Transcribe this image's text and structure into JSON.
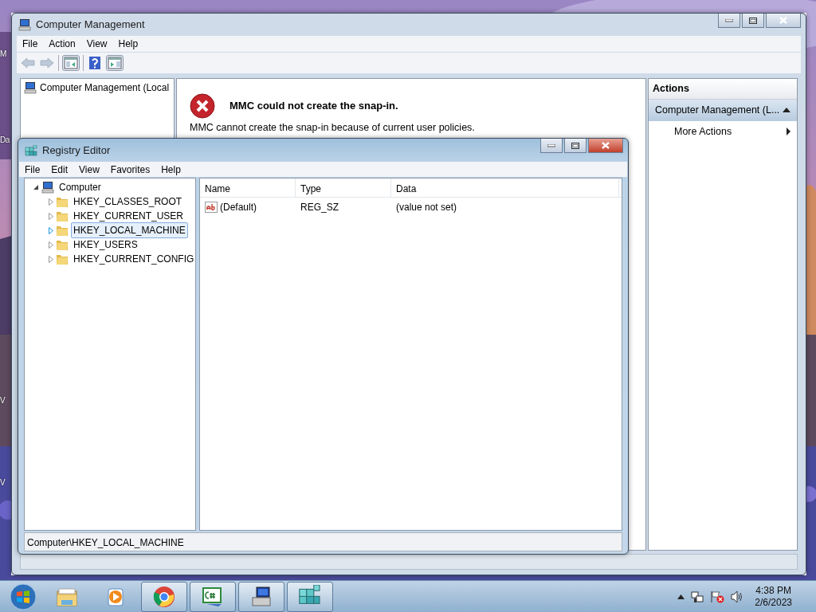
{
  "desktop": {
    "edge_labels": [
      "M",
      "Da",
      "V",
      "V"
    ]
  },
  "computer_management": {
    "title": "Computer Management",
    "menu": [
      "File",
      "Action",
      "View",
      "Help"
    ],
    "toolbar": [
      {
        "kind": "back",
        "disabled": true
      },
      {
        "kind": "forward",
        "disabled": true
      },
      {
        "kind": "tree_pane",
        "disabled": false
      },
      {
        "kind": "help",
        "disabled": false
      },
      {
        "kind": "action_pane",
        "disabled": false
      }
    ],
    "tree": [
      {
        "label": "Computer Management (Local",
        "selected": false
      }
    ],
    "error": {
      "title": "MMC could not create the snap-in.",
      "message": "MMC cannot create the snap-in because of current user policies."
    },
    "actions": {
      "header": "Actions",
      "section": {
        "label": "Computer Management (L...",
        "expanded": true
      },
      "items": [
        {
          "label": "More Actions"
        }
      ]
    }
  },
  "registry_editor": {
    "title": "Registry Editor",
    "menu": [
      "File",
      "Edit",
      "View",
      "Favorites",
      "Help"
    ],
    "tree": {
      "label": "Computer",
      "expanded": true,
      "children": [
        {
          "label": "HKEY_CLASSES_ROOT",
          "expanded": false,
          "selected": false
        },
        {
          "label": "HKEY_CURRENT_USER",
          "expanded": false,
          "selected": false
        },
        {
          "label": "HKEY_LOCAL_MACHINE",
          "expanded": false,
          "selected": true
        },
        {
          "label": "HKEY_USERS",
          "expanded": false,
          "selected": false
        },
        {
          "label": "HKEY_CURRENT_CONFIG",
          "expanded": false,
          "selected": false
        }
      ]
    },
    "columns": [
      "Name",
      "Type",
      "Data"
    ],
    "rows": [
      {
        "name": "(Default)",
        "type": "REG_SZ",
        "data": "(value not set)"
      }
    ],
    "status_bar": "Computer\\HKEY_LOCAL_MACHINE"
  },
  "taskbar": {
    "apps": [
      {
        "kind": "explorer",
        "running": false
      },
      {
        "kind": "media",
        "running": false
      },
      {
        "kind": "chrome",
        "running": true
      },
      {
        "kind": "csharp",
        "running": true
      },
      {
        "kind": "mmc",
        "running": true
      },
      {
        "kind": "regedit",
        "running": true
      }
    ],
    "clock": {
      "time": "4:38 PM",
      "date": "2/6/2023"
    }
  }
}
